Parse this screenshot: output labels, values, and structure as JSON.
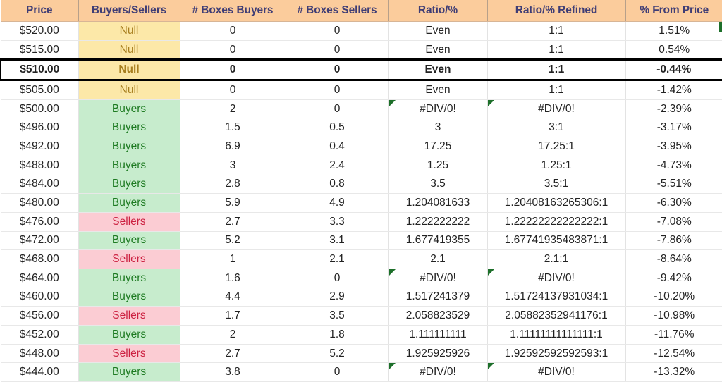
{
  "table": {
    "columns": [
      {
        "key": "price",
        "label": "Price"
      },
      {
        "key": "bs",
        "label": "Buyers/Sellers"
      },
      {
        "key": "bb",
        "label": "# Boxes Buyers"
      },
      {
        "key": "sb",
        "label": "# Boxes Sellers"
      },
      {
        "key": "ratio",
        "label": "Ratio/%"
      },
      {
        "key": "refined",
        "label": "Ratio/% Refined"
      },
      {
        "key": "pct",
        "label": "% From Price"
      }
    ],
    "header_bg": "#fbcc9c",
    "header_fg": "#3f3d75",
    "null_bg": "#fce8a8",
    "null_fg": "#a87f1f",
    "buyers_bg": "#c7eccd",
    "buyers_fg": "#1d7a21",
    "sellers_bg": "#fbccd3",
    "sellers_fg": "#cc2141",
    "error_flag_color": "#1d6f2a",
    "rows": [
      {
        "price": "$520.00",
        "bs": "Null",
        "cat": "null",
        "bb": "0",
        "sb": "0",
        "ratio": "Even",
        "ratio_err": false,
        "refined": "1:1",
        "refined_err": false,
        "pct": "1.51%",
        "highlight": false
      },
      {
        "price": "$515.00",
        "bs": "Null",
        "cat": "null",
        "bb": "0",
        "sb": "0",
        "ratio": "Even",
        "ratio_err": false,
        "refined": "1:1",
        "refined_err": false,
        "pct": "0.54%",
        "highlight": false
      },
      {
        "price": "$510.00",
        "bs": "Null",
        "cat": "null",
        "bb": "0",
        "sb": "0",
        "ratio": "Even",
        "ratio_err": false,
        "refined": "1:1",
        "refined_err": false,
        "pct": "-0.44%",
        "highlight": true
      },
      {
        "price": "$505.00",
        "bs": "Null",
        "cat": "null",
        "bb": "0",
        "sb": "0",
        "ratio": "Even",
        "ratio_err": false,
        "refined": "1:1",
        "refined_err": false,
        "pct": "-1.42%",
        "highlight": false
      },
      {
        "price": "$500.00",
        "bs": "Buyers",
        "cat": "buyers",
        "bb": "2",
        "sb": "0",
        "ratio": "#DIV/0!",
        "ratio_err": true,
        "refined": "#DIV/0!",
        "refined_err": true,
        "pct": "-2.39%",
        "highlight": false
      },
      {
        "price": "$496.00",
        "bs": "Buyers",
        "cat": "buyers",
        "bb": "1.5",
        "sb": "0.5",
        "ratio": "3",
        "ratio_err": false,
        "refined": "3:1",
        "refined_err": false,
        "pct": "-3.17%",
        "highlight": false
      },
      {
        "price": "$492.00",
        "bs": "Buyers",
        "cat": "buyers",
        "bb": "6.9",
        "sb": "0.4",
        "ratio": "17.25",
        "ratio_err": false,
        "refined": "17.25:1",
        "refined_err": false,
        "pct": "-3.95%",
        "highlight": false
      },
      {
        "price": "$488.00",
        "bs": "Buyers",
        "cat": "buyers",
        "bb": "3",
        "sb": "2.4",
        "ratio": "1.25",
        "ratio_err": false,
        "refined": "1.25:1",
        "refined_err": false,
        "pct": "-4.73%",
        "highlight": false
      },
      {
        "price": "$484.00",
        "bs": "Buyers",
        "cat": "buyers",
        "bb": "2.8",
        "sb": "0.8",
        "ratio": "3.5",
        "ratio_err": false,
        "refined": "3.5:1",
        "refined_err": false,
        "pct": "-5.51%",
        "highlight": false
      },
      {
        "price": "$480.00",
        "bs": "Buyers",
        "cat": "buyers",
        "bb": "5.9",
        "sb": "4.9",
        "ratio": "1.204081633",
        "ratio_err": false,
        "refined": "1.20408163265306:1",
        "refined_err": false,
        "pct": "-6.30%",
        "highlight": false
      },
      {
        "price": "$476.00",
        "bs": "Sellers",
        "cat": "sellers",
        "bb": "2.7",
        "sb": "3.3",
        "ratio": "1.222222222",
        "ratio_err": false,
        "refined": "1.22222222222222:1",
        "refined_err": false,
        "pct": "-7.08%",
        "highlight": false
      },
      {
        "price": "$472.00",
        "bs": "Buyers",
        "cat": "buyers",
        "bb": "5.2",
        "sb": "3.1",
        "ratio": "1.677419355",
        "ratio_err": false,
        "refined": "1.67741935483871:1",
        "refined_err": false,
        "pct": "-7.86%",
        "highlight": false
      },
      {
        "price": "$468.00",
        "bs": "Sellers",
        "cat": "sellers",
        "bb": "1",
        "sb": "2.1",
        "ratio": "2.1",
        "ratio_err": false,
        "refined": "2.1:1",
        "refined_err": false,
        "pct": "-8.64%",
        "highlight": false
      },
      {
        "price": "$464.00",
        "bs": "Buyers",
        "cat": "buyers",
        "bb": "1.6",
        "sb": "0",
        "ratio": "#DIV/0!",
        "ratio_err": true,
        "refined": "#DIV/0!",
        "refined_err": true,
        "pct": "-9.42%",
        "highlight": false
      },
      {
        "price": "$460.00",
        "bs": "Buyers",
        "cat": "buyers",
        "bb": "4.4",
        "sb": "2.9",
        "ratio": "1.517241379",
        "ratio_err": false,
        "refined": "1.51724137931034:1",
        "refined_err": false,
        "pct": "-10.20%",
        "highlight": false
      },
      {
        "price": "$456.00",
        "bs": "Sellers",
        "cat": "sellers",
        "bb": "1.7",
        "sb": "3.5",
        "ratio": "2.058823529",
        "ratio_err": false,
        "refined": "2.05882352941176:1",
        "refined_err": false,
        "pct": "-10.98%",
        "highlight": false
      },
      {
        "price": "$452.00",
        "bs": "Buyers",
        "cat": "buyers",
        "bb": "2",
        "sb": "1.8",
        "ratio": "1.111111111",
        "ratio_err": false,
        "refined": "1.11111111111111:1",
        "refined_err": false,
        "pct": "-11.76%",
        "highlight": false
      },
      {
        "price": "$448.00",
        "bs": "Sellers",
        "cat": "sellers",
        "bb": "2.7",
        "sb": "5.2",
        "ratio": "1.925925926",
        "ratio_err": false,
        "refined": "1.92592592592593:1",
        "refined_err": false,
        "pct": "-12.54%",
        "highlight": false
      },
      {
        "price": "$444.00",
        "bs": "Buyers",
        "cat": "buyers",
        "bb": "3.8",
        "sb": "0",
        "ratio": "#DIV/0!",
        "ratio_err": true,
        "refined": "#DIV/0!",
        "refined_err": true,
        "pct": "-13.32%",
        "highlight": false
      }
    ]
  }
}
